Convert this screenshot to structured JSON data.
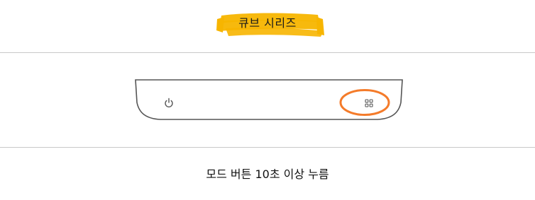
{
  "header": {
    "title": "큐브 시리즈",
    "highlight_color": "#F7B500"
  },
  "device": {
    "left_icon": "power-icon",
    "right_icon": "mode-grid-icon",
    "highlight_ring_color": "#F47B2A",
    "outline_color": "#555555"
  },
  "instruction": {
    "text": "모드 버튼 10초 이상 누름"
  }
}
